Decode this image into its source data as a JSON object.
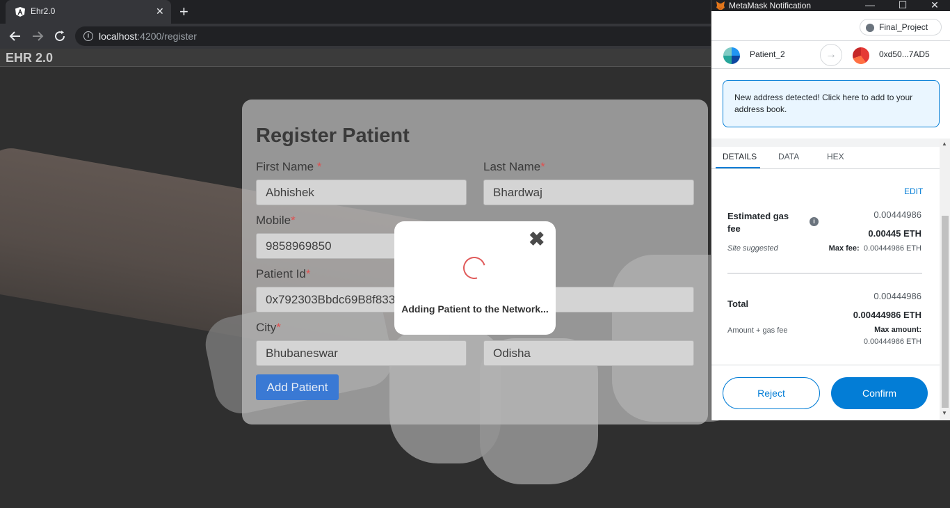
{
  "browser": {
    "tab_title": "Ehr2.0",
    "tab_close": "✕",
    "new_tab": "+",
    "url_host": "localhost",
    "url_path": ":4200/register"
  },
  "app": {
    "brand": "EHR 2.0",
    "form": {
      "title": "Register Patient",
      "fields": [
        {
          "label": "First Name ",
          "required": "*",
          "value": "Abhishek"
        },
        {
          "label": "Last Name",
          "required": "*",
          "value": "Bhardwaj"
        },
        {
          "label": "Mobile",
          "required": "*",
          "value": "9858969850"
        },
        {
          "label": "Patient Id",
          "required": "*",
          "value": "0x792303Bbdc69B8f833"
        },
        {
          "label": "",
          "required": "",
          "value": ""
        },
        {
          "label": "City",
          "required": "*",
          "value": "Bhubaneswar"
        },
        {
          "label": "",
          "required": "",
          "value": "Odisha"
        }
      ],
      "submit_label": "Add Patient"
    },
    "dialog": {
      "close": "✖",
      "message": "Adding Patient to the Network..."
    }
  },
  "metamask": {
    "window_title": "MetaMask Notification",
    "network": "Final_Project",
    "from_account": "Patient_2",
    "to_address": "0xd50...7AD5",
    "arrow": "→",
    "notice": "New address detected! Click here to add to your address book.",
    "tabs": [
      "DETAILS",
      "DATA",
      "HEX"
    ],
    "edit_label": "EDIT",
    "gas": {
      "label": "Estimated gas fee",
      "info": "i",
      "value_secondary": "0.00444986",
      "value_primary": "0.00445 ETH",
      "site_suggested": "Site suggested",
      "max_fee_label": "Max fee:",
      "max_fee_value": "0.00444986 ETH"
    },
    "total": {
      "label": "Total",
      "value_secondary": "0.00444986",
      "value_primary": "0.00444986 ETH",
      "sub_label": "Amount + gas fee",
      "max_amount_label": "Max amount:",
      "max_amount_value": "0.00444986 ETH"
    },
    "reject_label": "Reject",
    "confirm_label": "Confirm",
    "accent_color": "#037dd6"
  }
}
